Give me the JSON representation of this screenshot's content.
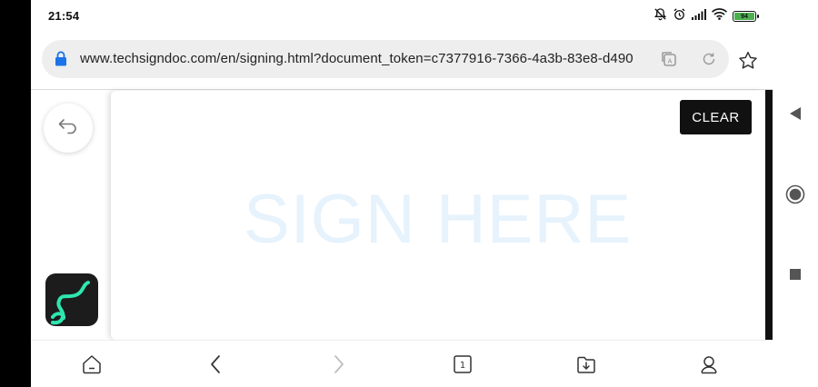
{
  "status_bar": {
    "time": "21:54",
    "battery_level": "94",
    "icons": [
      "mute-bell-icon",
      "alarm-icon",
      "signal-icon",
      "wifi-icon",
      "battery-icon"
    ]
  },
  "browser": {
    "url": "www.techsigndoc.com/en/signing.html?document_token=c7377916-7366-4a3b-83e8-d490",
    "icons": [
      "lock-icon",
      "translate-icon",
      "reload-icon",
      "star-icon"
    ]
  },
  "page": {
    "signature_placeholder": "SIGN HERE",
    "clear_label": "CLEAR",
    "placeholder_color": "#e6f2fc",
    "logo_accent_color": "#2ee6b0"
  },
  "toolbar": {
    "tab_count": "1",
    "icons": [
      "home-icon",
      "back-icon",
      "forward-icon",
      "tabs-icon",
      "downloads-icon",
      "profile-icon"
    ]
  },
  "system_nav": {
    "icons": [
      "nav-back-icon",
      "nav-home-icon",
      "nav-recents-icon"
    ]
  }
}
